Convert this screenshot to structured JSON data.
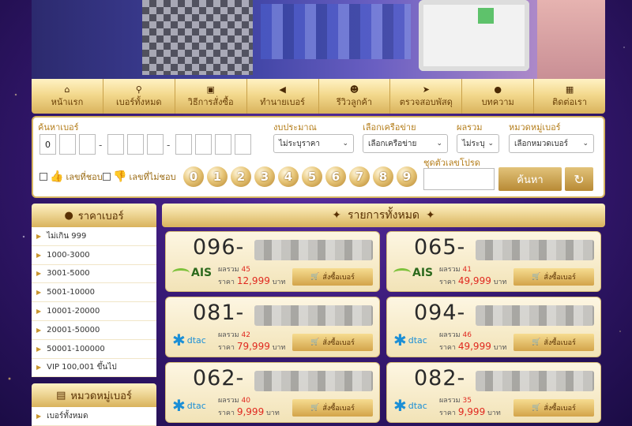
{
  "nav": [
    {
      "label": "หน้าแรก",
      "icon": "home-icon",
      "glyph": "⌂"
    },
    {
      "label": "เบอร์ทั้งหมด",
      "icon": "search-icon",
      "glyph": "⚲"
    },
    {
      "label": "วิธีการสั่งซื้อ",
      "icon": "box-icon",
      "glyph": "▣"
    },
    {
      "label": "ทำนายเบอร์",
      "icon": "megaphone-icon",
      "glyph": "◀"
    },
    {
      "label": "รีวิวลูกค้า",
      "icon": "users-icon",
      "glyph": "☻"
    },
    {
      "label": "ตรวจสอบพัสดุ",
      "icon": "paper-plane-icon",
      "glyph": "➤"
    },
    {
      "label": "บทความ",
      "icon": "chat-icon",
      "glyph": "●"
    },
    {
      "label": "ติดต่อเรา",
      "icon": "map-icon",
      "glyph": "▦"
    }
  ],
  "search": {
    "number_label": "ค้นหาเบอร์",
    "first_digit": "0",
    "budget_label": "งบประมาณ",
    "budget_value": "ไม่ระบุราคา",
    "network_label": "เลือกเครือข่าย",
    "network_value": "เลือกเครือข่าย",
    "sum_label": "ผลรวม",
    "sum_value": "ไม่ระบุ",
    "category_label": "หมวดหมู่เบอร์",
    "category_value": "เลือกหมวดเบอร์",
    "like_label": "เลขที่ชอบ",
    "dislike_label": "เลขที่ไม่ชอบ",
    "pattern_label": "ชุดตัวเลขโปรด",
    "search_button": "ค้นหา",
    "reset_glyph": "↻",
    "balls": [
      "0",
      "1",
      "2",
      "3",
      "4",
      "5",
      "6",
      "7",
      "8",
      "9"
    ]
  },
  "sidebar_price": {
    "title": "ราคาเบอร์",
    "items": [
      "ไม่เกิน 999",
      "1000-3000",
      "3001-5000",
      "5001-10000",
      "10001-20000",
      "20001-50000",
      "50001-100000",
      "VIP 100,001 ขึ้นไป"
    ]
  },
  "sidebar_category": {
    "title": "หมวดหมู่เบอร์",
    "items": [
      "เบอร์ทั้งหมด"
    ]
  },
  "content": {
    "title": "รายการทั้งหมด",
    "sum_label": "ผลรวม",
    "price_label": "ราคา",
    "currency": "บาท",
    "buy_label": "สั่งซื้อเบอร์",
    "cards": [
      {
        "prefix": "096-",
        "network": "AIS",
        "sum": "45",
        "price": "12,999"
      },
      {
        "prefix": "065-",
        "network": "AIS",
        "sum": "41",
        "price": "49,999"
      },
      {
        "prefix": "081-",
        "network": "dtac",
        "sum": "42",
        "price": "79,999"
      },
      {
        "prefix": "094-",
        "network": "dtac",
        "sum": "46",
        "price": "49,999"
      },
      {
        "prefix": "062-",
        "network": "dtac",
        "sum": "40",
        "price": "9,999"
      },
      {
        "prefix": "082-",
        "network": "dtac",
        "sum": "35",
        "price": "9,999"
      }
    ]
  }
}
